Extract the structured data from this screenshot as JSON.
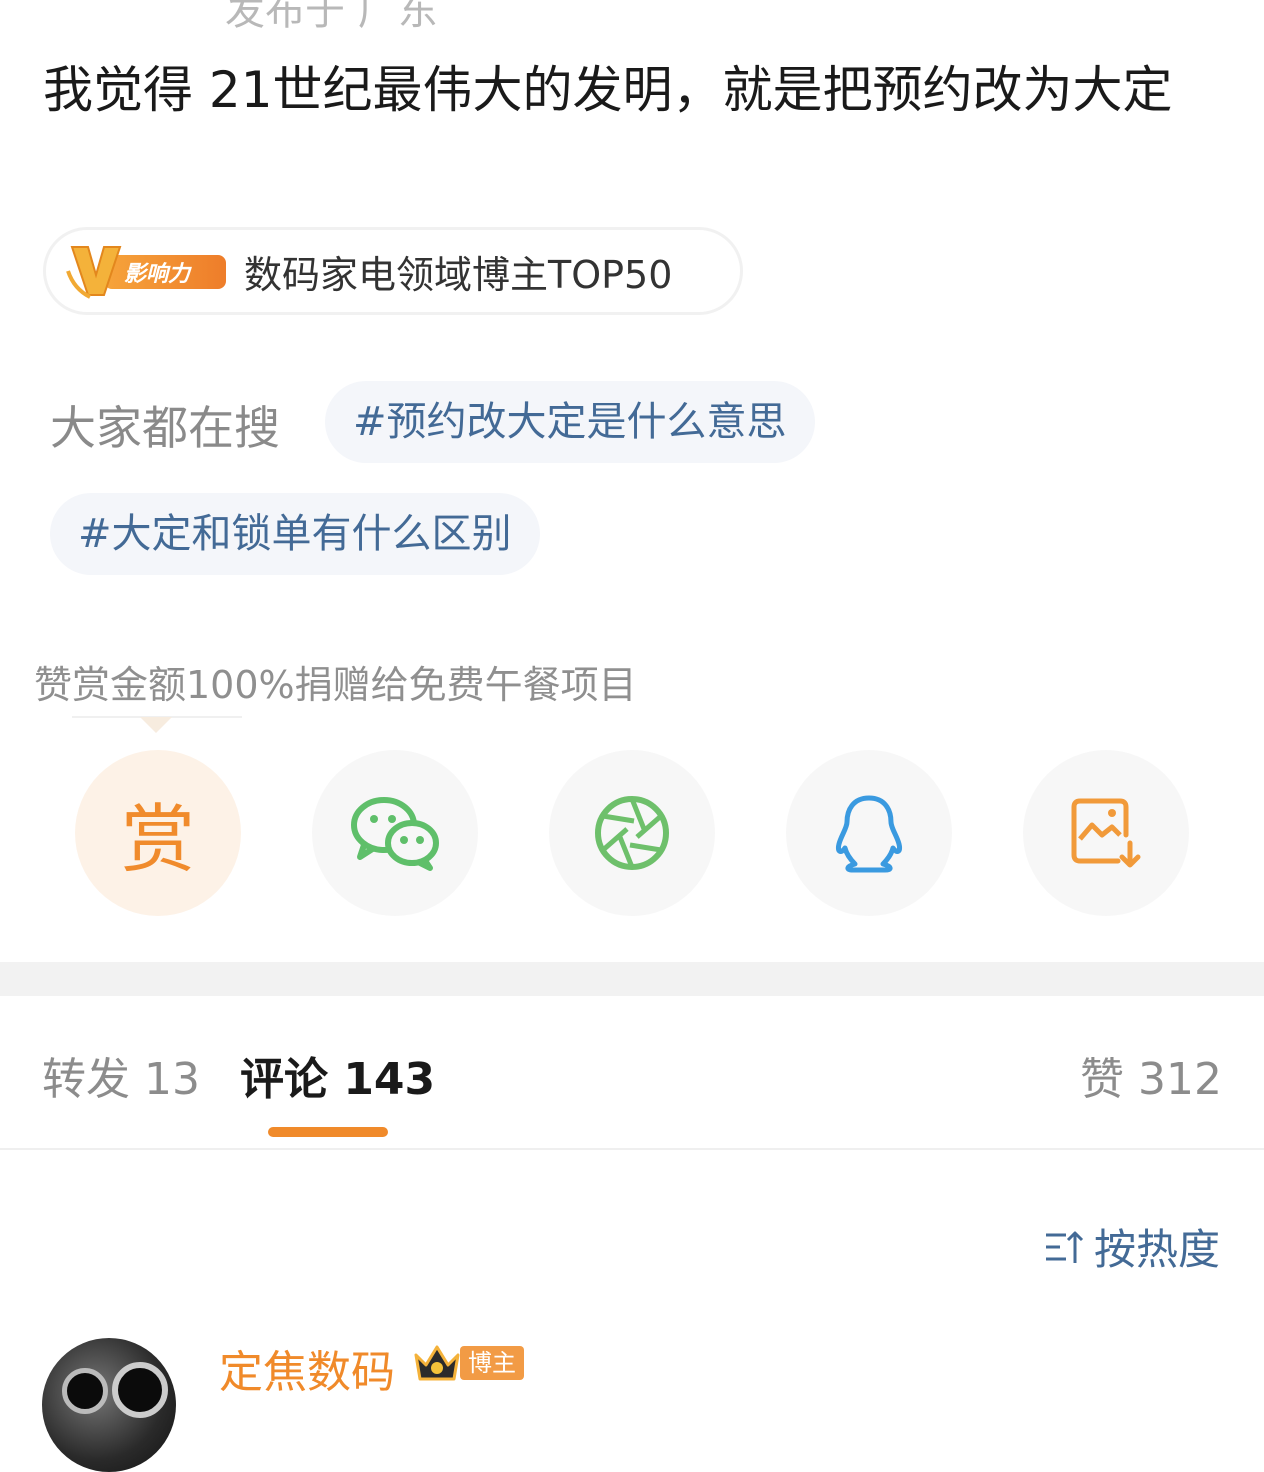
{
  "post": {
    "location_partial": "发布于 广东",
    "text": "我觉得 21世纪最伟大的发明，就是把预约改为大定"
  },
  "badge": {
    "icon_label": "影响力",
    "text": "数码家电领域博主TOP50"
  },
  "hot_search": {
    "label": "大家都在搜",
    "chips": [
      "#预约改大定是什么意思",
      "#大定和锁单有什么区别"
    ]
  },
  "reward": {
    "note": "赞赏金额100%捐赠给免费午餐项目",
    "button_char": "赏"
  },
  "share": {
    "icons": [
      "reward-icon",
      "wechat-icon",
      "moments-icon",
      "qq-icon",
      "save-image-icon"
    ]
  },
  "tabs": {
    "repost": "转发 13",
    "comment": "评论 143",
    "like": "赞 312"
  },
  "sort": {
    "label": "按热度"
  },
  "comment": {
    "username": "定焦数码",
    "tag": "博主"
  },
  "colors": {
    "accent": "#f08a2a",
    "link": "#436a96",
    "wechat": "#5fbf6a",
    "qq": "#3a9ae0"
  }
}
